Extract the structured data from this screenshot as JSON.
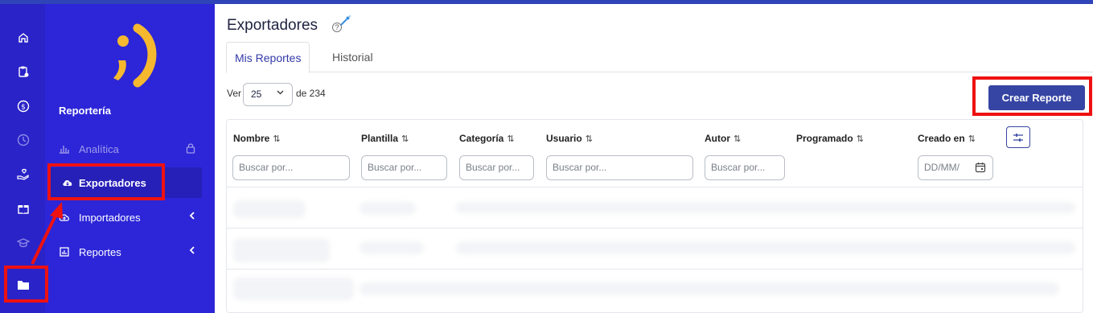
{
  "rail": {
    "icons": [
      "home-icon",
      "clipboard-icon",
      "dollar-icon",
      "clock-icon",
      "hand-heart-icon",
      "gift-icon",
      "graduation-cap-icon",
      "folder-icon"
    ]
  },
  "brand": {
    "logo_text": ";)"
  },
  "submenu": {
    "section_title": "Reportería",
    "items": [
      {
        "label": "Analítica",
        "icon": "chart-icon",
        "right_icon": "lock-icon",
        "disabled": true
      },
      {
        "label": "Exportadores",
        "icon": "cloud-download-icon",
        "active": true
      },
      {
        "label": "Importadores",
        "icon": "cloud-upload-icon",
        "right_icon": "chevron-left-icon"
      },
      {
        "label": "Reportes",
        "icon": "report-icon",
        "right_icon": "chevron-left-icon"
      }
    ]
  },
  "page": {
    "title": "Exportadores",
    "help": "?",
    "tabs": [
      {
        "label": "Mis Reportes",
        "active": true
      },
      {
        "label": "Historial",
        "active": false
      }
    ],
    "pagination": {
      "ver_label": "Ver",
      "page_size": "25",
      "total_label": "de 234"
    },
    "create_button": "Crear Reporte"
  },
  "table": {
    "columns": [
      {
        "label": "Nombre",
        "placeholder": "Buscar por..."
      },
      {
        "label": "Plantilla",
        "placeholder": "Buscar por..."
      },
      {
        "label": "Categoría",
        "placeholder": "Buscar por..."
      },
      {
        "label": "Usuario",
        "placeholder": "Buscar por..."
      },
      {
        "label": "Autor",
        "placeholder": "Buscar por..."
      },
      {
        "label": "Programado",
        "placeholder": ""
      },
      {
        "label": "Creado en",
        "placeholder": "DD/MM/"
      }
    ],
    "sort_glyph": "⇅"
  },
  "colors": {
    "sidebar_rail": "#2a23c8",
    "sidebar_panel": "#2d26d8",
    "logo": "#f5b82e",
    "primary_button": "#3645a3",
    "annotation": "#ee1111"
  }
}
